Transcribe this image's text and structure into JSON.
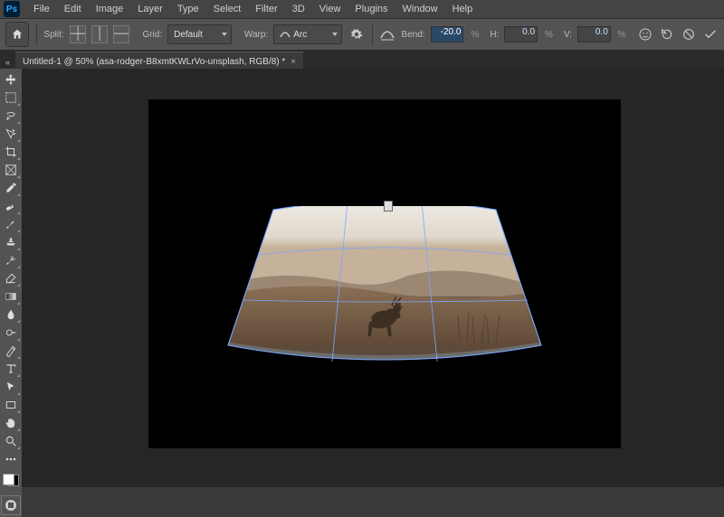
{
  "app": {
    "short": "Ps"
  },
  "menu": [
    "File",
    "Edit",
    "Image",
    "Layer",
    "Type",
    "Select",
    "Filter",
    "3D",
    "View",
    "Plugins",
    "Window",
    "Help"
  ],
  "options": {
    "split_label": "Split:",
    "grid_label": "Grid:",
    "grid_value": "Default",
    "warp_label": "Warp:",
    "warp_value": "Arc",
    "bend_label": "Bend:",
    "bend_value": "-20.0",
    "h_label": "H:",
    "h_value": "0.0",
    "v_label": "V:",
    "v_value": "0.0",
    "pct": "%"
  },
  "document": {
    "tab_title": "Untitled-1 @ 50% (asa-rodger-B8xmtKWLrVo-unsplash, RGB/8) *"
  },
  "toolbar_collapse": "«"
}
